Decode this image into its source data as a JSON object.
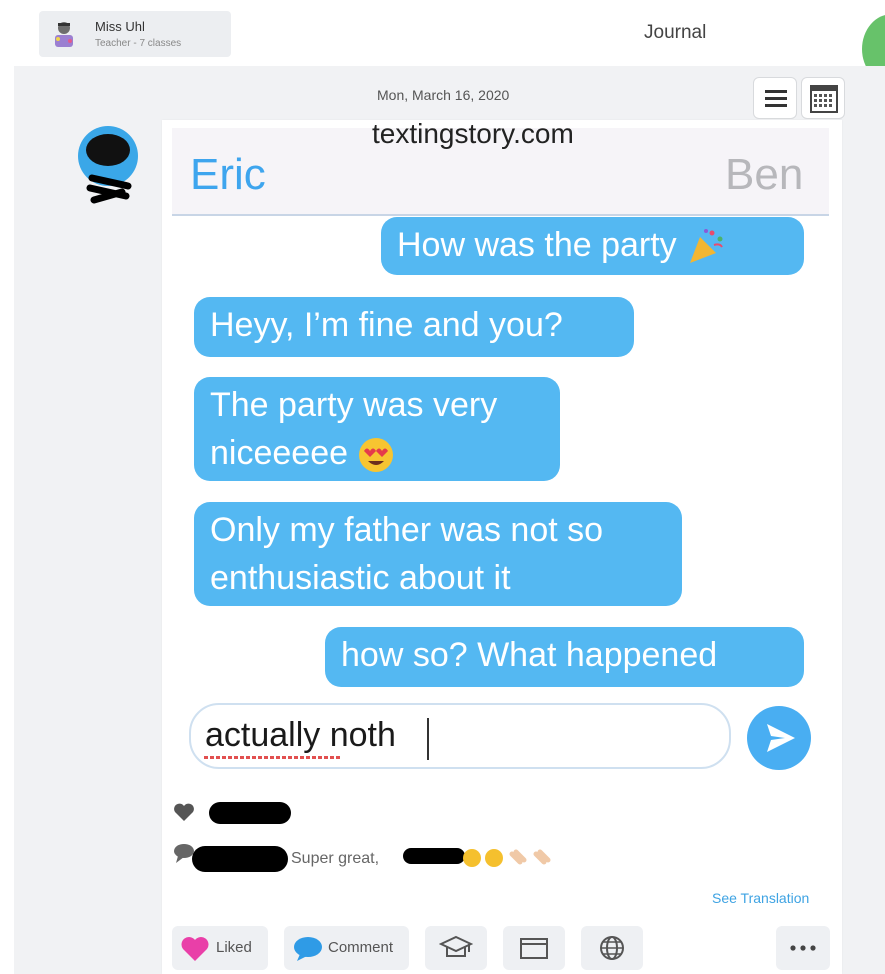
{
  "header": {
    "teacher_name": "Miss Uhl",
    "teacher_sub": "Teacher - 7 classes",
    "title": "Journal"
  },
  "post": {
    "date": "Mon, March 16, 2020",
    "watermark": "textingstory.com",
    "contact_left": "Eric",
    "contact_right": "Ben",
    "messages": [
      {
        "text": "How was the party",
        "side": "right",
        "emoji": "party-popper"
      },
      {
        "text": "Heyy, I’m fine and you?",
        "side": "left"
      },
      {
        "text": "The party was very",
        "text2": "niceeeee",
        "side": "left",
        "emoji": "heart-eyes"
      },
      {
        "text": "Only my father was not so",
        "text2": "enthusiastic about it",
        "side": "left"
      },
      {
        "text": "how so? What happened",
        "side": "right"
      }
    ],
    "input_value": "actually noth"
  },
  "social": {
    "comment_text": "Super great,",
    "see_translation": "See Translation"
  },
  "actions": {
    "liked_label": "Liked",
    "comment_label": "Comment"
  },
  "colors": {
    "bubble": "#54b8f2",
    "contact_left": "#3ea5ee",
    "liked_heart": "#e93fa8",
    "green_accent": "#67c26a"
  }
}
